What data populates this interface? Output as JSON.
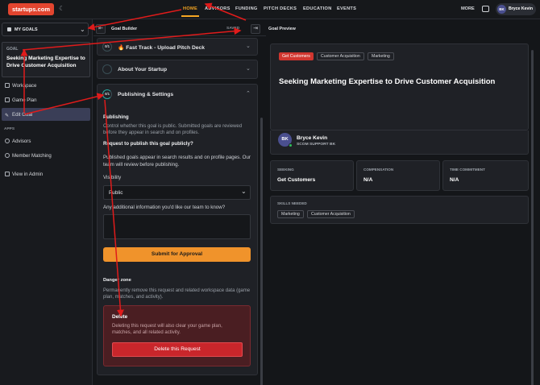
{
  "nav": {
    "logo": "startups.com",
    "items": [
      "HOME",
      "ADVISORS",
      "FUNDING",
      "PITCH DECKS",
      "EDUCATION",
      "EVENTS"
    ],
    "more": "MORE",
    "user_initials": "BK",
    "user_name": "Bryce Kevin"
  },
  "sidebar": {
    "goal_select": "MY GOALS",
    "goal_label": "GOAL",
    "goal_title": "Seeking Marketing Expertise to Drive Customer Acquisition",
    "links": [
      "Workspace",
      "Game Plan",
      "Edit Goal"
    ],
    "apps_label": "APPS",
    "apps": [
      "Advisors",
      "Member Matching",
      "View in Admin"
    ]
  },
  "builder": {
    "title": "Goal Builder",
    "saved": "SAVED",
    "sections": [
      {
        "step": "0/1",
        "title": "Fast Track - Upload Pitch Deck"
      },
      {
        "step": "",
        "title": "About Your Startup"
      },
      {
        "step": "0/1",
        "title": "Publishing & Settings"
      }
    ],
    "publishing": {
      "heading": "Publishing",
      "desc": "Control whether this goal is public. Submitted goals are reviewed before they appear in search and on profiles.",
      "question": "Request to publish this goal publicly?",
      "info": "Published goals appear in search results and on profile pages. Our team will review before publishing.",
      "visibility_label": "Visibility",
      "visibility_value": "Public",
      "additional_label": "Any additional information you'd like our team to know?",
      "submit": "Submit for Approval",
      "danger_heading": "Danger zone",
      "danger_desc": "Permanently remove this request and related workspace data (game plan, matches, and activity).",
      "delete_title": "Delete",
      "delete_desc": "Deleting this request will also clear your game plan, matches, and all related activity.",
      "delete_button": "Delete this Request"
    }
  },
  "preview": {
    "title": "Goal Preview",
    "tags": [
      "Get Customers",
      "Customer Acquisition",
      "Marketing"
    ],
    "goal_title": "Seeking Marketing Expertise to Drive Customer Acquisition",
    "owner_initials": "BK",
    "owner_name": "Bryce Kevin",
    "owner_sub": "SCOM SUPPORT BK",
    "stats": [
      {
        "label": "SEEKING",
        "value": "Get Customers"
      },
      {
        "label": "COMPENSATION",
        "value": "N/A"
      },
      {
        "label": "TIME COMMITMENT",
        "value": "N/A"
      }
    ],
    "skills_label": "SKILLS NEEDED",
    "skills": [
      "Marketing",
      "Customer Acquisition"
    ]
  },
  "colors": {
    "accent": "#f5a623",
    "brand": "#e2452f",
    "danger": "#c9262b",
    "annotation": "#e01b1b"
  }
}
